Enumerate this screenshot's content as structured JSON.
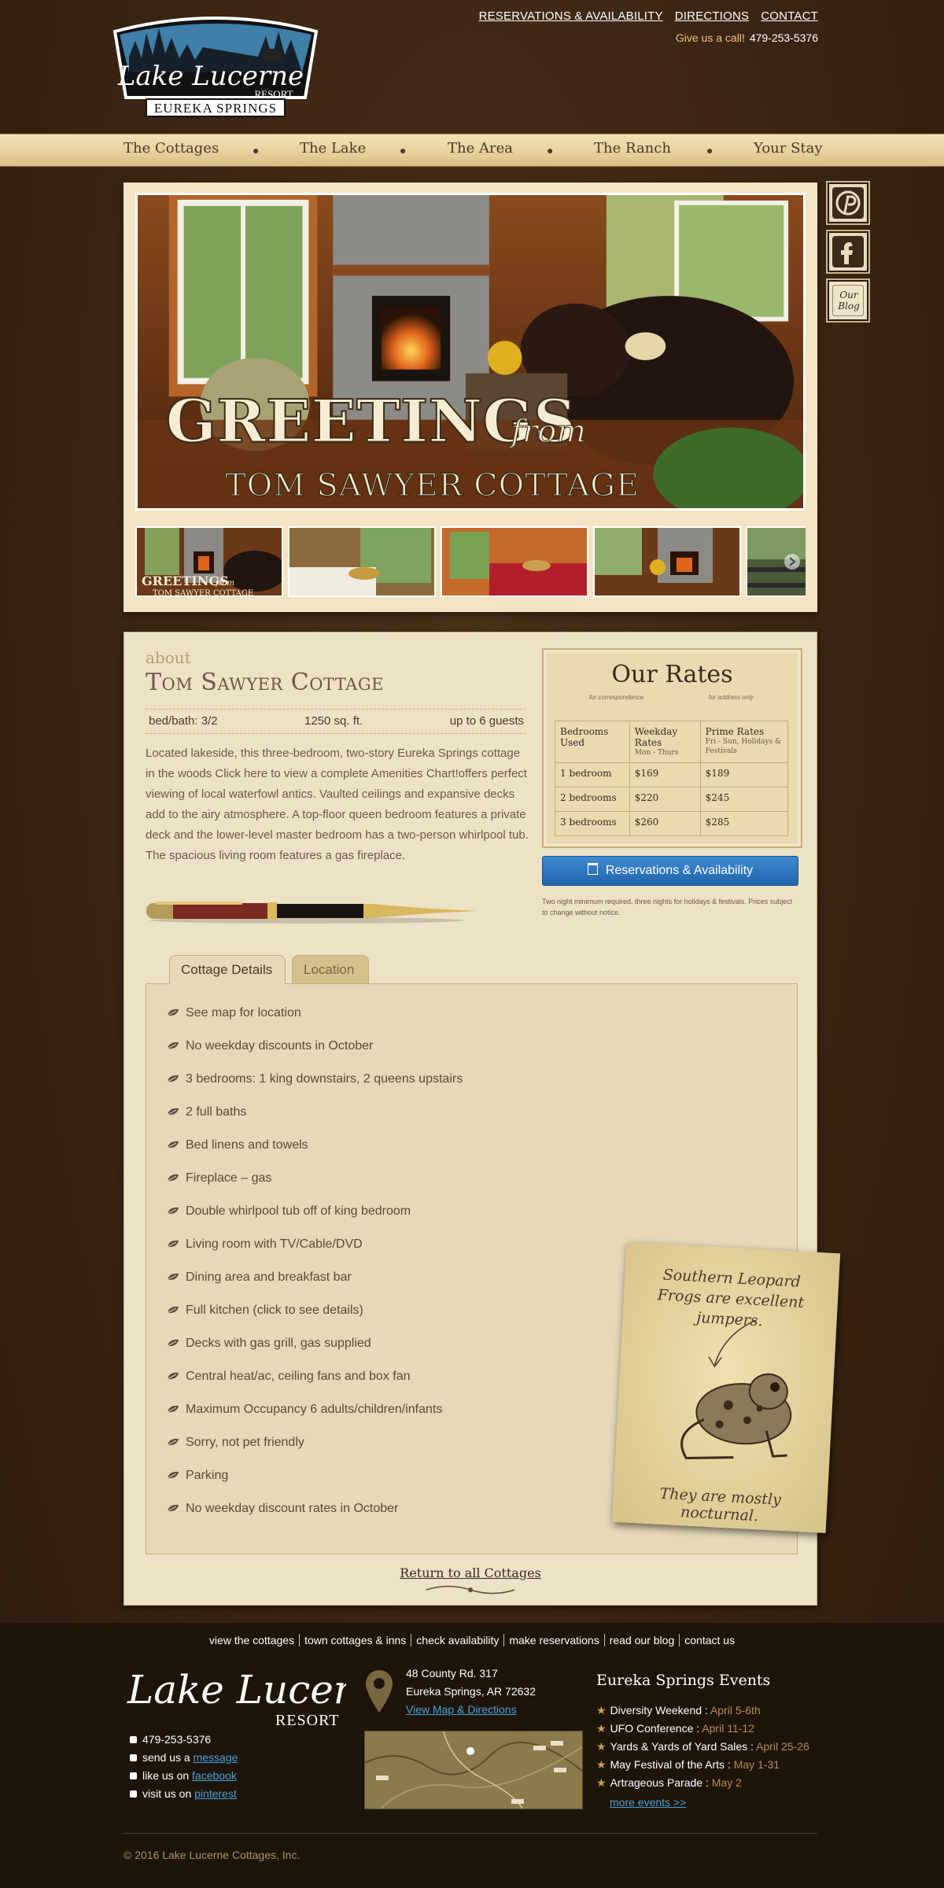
{
  "header": {
    "logo": {
      "line1": "Lake Lucerne",
      "line2": "RESORT",
      "line3": "EUREKA SPRINGS"
    },
    "links": [
      "RESERVATIONS & AVAILABILITY",
      "DIRECTIONS",
      "CONTACT"
    ],
    "call_label": "Give us a call!",
    "phone": "479-253-5376"
  },
  "nav": [
    "The Cottages",
    "The Lake",
    "The Area",
    "The Ranch",
    "Your Stay"
  ],
  "social": [
    "pinterest-icon",
    "facebook-icon",
    "blog-icon"
  ],
  "social_blog_text": [
    "Our",
    "Blog"
  ],
  "hero": {
    "line1": "GREETINGS",
    "line1b": "from",
    "line2": "TOM SAWYER COTTAGE"
  },
  "thumb_caption": {
    "line1": "GREETINGS",
    "line1b": "from",
    "line2": "TOM SAWYER COTTAGE"
  },
  "about": {
    "label": "about",
    "title": "Tom Sawyer Cottage",
    "bedbath": "bed/bath: 3/2",
    "sqft": "1250 sq. ft.",
    "guests": "up to 6 guests",
    "description": "Located lakeside, this three-bedroom, two-story Eureka Springs cottage in the woods Click here to view a complete Amenities Chart!offers perfect viewing of local waterfowl antics. Vaulted ceilings and expansive decks add to the airy atmosphere. A top-floor queen bedroom features a private deck and the lower-level master bedroom has a two-person whirlpool tub. The spacious living room features a gas fireplace."
  },
  "rates": {
    "title": "Our Rates",
    "sub_left": "for correspondence",
    "sub_right": "for address only",
    "headers": [
      {
        "label": "Bedrooms Used",
        "sub": ""
      },
      {
        "label": "Weekday Rates",
        "sub": "Mon - Thurs"
      },
      {
        "label": "Prime Rates",
        "sub": "Fri - Sun, Holidays & Festivals"
      }
    ],
    "rows": [
      [
        "1 bedroom",
        "$169",
        "$189"
      ],
      [
        "2 bedrooms",
        "$220",
        "$245"
      ],
      [
        "3 bedrooms",
        "$260",
        "$285"
      ]
    ],
    "button": "Reservations & Availability",
    "note": "Two night minimum required, three nights for holidays & festivals. Prices subject to change without notice."
  },
  "tabs": [
    "Cottage Details",
    "Location"
  ],
  "details": [
    "See map for location",
    "No weekday discounts in October",
    "3 bedrooms: 1 king downstairs, 2 queens upstairs",
    "2 full baths",
    "Bed linens and towels",
    "Fireplace – gas",
    "Double whirlpool tub off of king bedroom",
    "Living room with TV/Cable/DVD",
    "Dining area and breakfast bar",
    "Full kitchen (click to see details)",
    "Decks with gas grill, gas supplied",
    "Central heat/ac, ceiling fans and box fan",
    "Maximum Occupancy 6 adults/children/infants",
    "Sorry, not pet friendly",
    "Parking",
    "No weekday discount rates in October"
  ],
  "frog": {
    "top": "Southern Leopard Frogs are excellent jumpers.",
    "bottom": "They are mostly nocturnal."
  },
  "return_link": "Return to all Cottages",
  "footer": {
    "links": [
      "view the cottages",
      "town cottages & inns",
      "check availability",
      "make reservations",
      "read our blog",
      "contact us"
    ],
    "logo": {
      "line1": "Lake Lucerne",
      "line2": "RESORT"
    },
    "phone": "479-253-5376",
    "send_prefix": "send us a",
    "send_link": "message",
    "like_prefix": "like us on",
    "like_link": "facebook",
    "visit_prefix": "visit us on",
    "visit_link": "pinterest",
    "address1": "48 County Rd. 317",
    "address2": "Eureka Springs, AR  72632",
    "map_link": "View Map & Directions",
    "events_title": "Eureka Springs Events",
    "events": [
      {
        "name": "Diversity Weekend :",
        "date": "April 5-6th"
      },
      {
        "name": "UFO Conference :",
        "date": "April 11-12"
      },
      {
        "name": "Yards & Yards of Yard Sales :",
        "date": "April 25-26"
      },
      {
        "name": "May Festival of the Arts :",
        "date": "May 1-31"
      },
      {
        "name": "Artrageous Parade :",
        "date": "May 2"
      }
    ],
    "more_events": "more events >>",
    "copyright": "© 2016 Lake Lucerne Cottages, Inc."
  }
}
